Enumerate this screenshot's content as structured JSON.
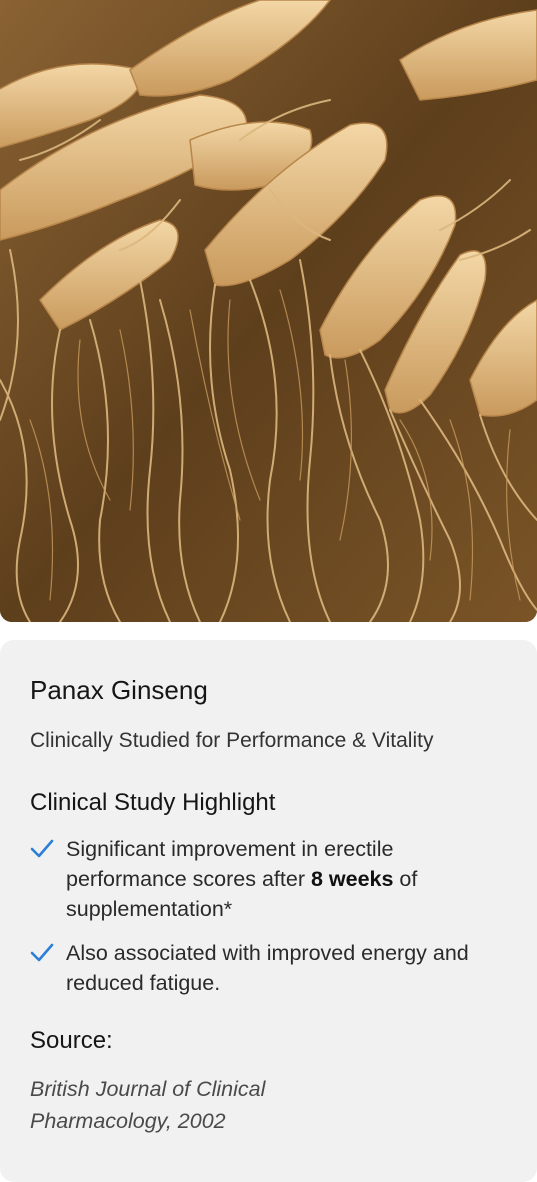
{
  "hero": {
    "image_alt": "Ginseng roots"
  },
  "card": {
    "title": "Panax Ginseng",
    "subtitle": "Clinically Studied for Performance & Vitality",
    "study_heading": "Clinical Study Highlight",
    "highlights": [
      {
        "icon": "check-icon",
        "text_before": "Significant improvement in erectile performance scores after ",
        "text_bold": "8 weeks",
        "text_after": " of supplementation*"
      },
      {
        "icon": "check-icon",
        "text_before": "Also associated with improved energy and reduced fatigue.",
        "text_bold": "",
        "text_after": ""
      }
    ],
    "source_heading": "Source:",
    "source_text": "British Journal of Clinical Pharmacology, 2002"
  },
  "colors": {
    "card_background": "#f1f1f1",
    "check_color": "#2b7fd8",
    "text_primary": "#161616",
    "text_secondary": "#4a4a4a"
  }
}
